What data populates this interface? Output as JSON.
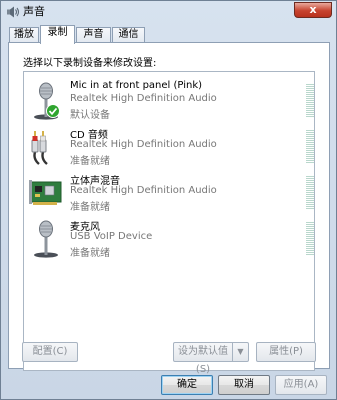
{
  "window": {
    "title": "声音",
    "close_label": "x"
  },
  "tabs": [
    {
      "label": "播放",
      "active": false
    },
    {
      "label": "录制",
      "active": true
    },
    {
      "label": "声音",
      "active": false
    },
    {
      "label": "通信",
      "active": false
    }
  ],
  "panel": {
    "instruction": "选择以下录制设备来修改设置:",
    "devices": [
      {
        "name": "Mic in at front panel (Pink)",
        "driver": "Realtek High Definition Audio",
        "status": "默认设备",
        "icon": "microphone-default-icon",
        "level": 0
      },
      {
        "name": "CD 音频",
        "driver": "Realtek High Definition Audio",
        "status": "准备就绪",
        "icon": "cd-audio-cable-icon",
        "level": 0
      },
      {
        "name": "立体声混音",
        "driver": "Realtek High Definition Audio",
        "status": "准备就绪",
        "icon": "sound-card-icon",
        "level": 0
      },
      {
        "name": "麦克风",
        "driver": "USB VoIP Device",
        "status": "准备就绪",
        "icon": "microphone-icon",
        "level": 0
      }
    ]
  },
  "buttons": {
    "configure": "配置(C)",
    "set_default": "设为默认值(S)",
    "properties": "属性(P)",
    "ok": "确定",
    "cancel": "取消",
    "apply": "应用(A)"
  },
  "colors": {
    "accent": "#3c7fb1",
    "meter": "#b9d7cc",
    "default_check": "#2fa52f"
  }
}
